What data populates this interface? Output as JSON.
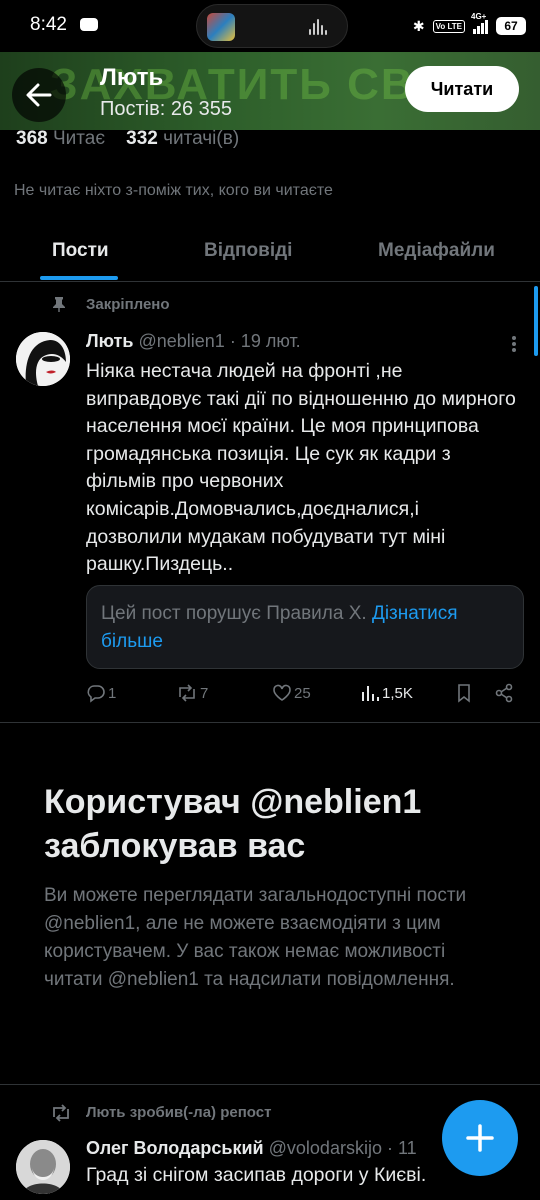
{
  "status_bar": {
    "time": "8:42",
    "battery": "67",
    "network": "4G+",
    "volte": "Vo LTE"
  },
  "header": {
    "banner_text": "ЗАХВАТИТЬ СВ",
    "name": "Лють",
    "posts_count": "Постів: 26 355",
    "follow_label": "Читати"
  },
  "stats": {
    "following_count": "368",
    "following_label": "Читає",
    "followers_count": "332",
    "followers_label": "читачі(в)"
  },
  "not_followed_text": "Не читає ніхто з-поміж тих, кого ви читаєте",
  "tabs": [
    {
      "label": "Пости"
    },
    {
      "label": "Відповіді"
    },
    {
      "label": "Медіафайли"
    }
  ],
  "pinned_post": {
    "pinned_label": "Закріплено",
    "author_name": "Лють",
    "handle": "@neblien1",
    "date": "· 19 лют.",
    "text": "Ніяка нестача людей на фронті ,не виправдовує такі дії по відношенню до мирного населення моєї країни. Це моя принципова громадянська позиція. Це сук як кадри з фільмів про червоних комісарів.Домовчались,доєдналися,і дозволили мудакам побудувати тут міні рашку.Пиздець..",
    "notice_text": "Цей пост порушує Правила X.",
    "notice_link": "Дізнатися більше",
    "replies": "1",
    "reposts": "7",
    "likes": "25",
    "views": "1,5K"
  },
  "blocked": {
    "title": "Користувач @neblien1 заблокував вас",
    "text": "Ви можете переглядати загальнодоступні пости @neblien1, але не можете взаємодіяти з цим користувачем. У вас також немає можливості читати @neblien1 та надсилати повідомлення."
  },
  "repost": {
    "label": "Лють зробив(-ла) репост",
    "author_name": "Олег Володарський",
    "handle": "@volodarskijo",
    "date": "· 11",
    "text": "Град зі снігом засипав дороги у Києві."
  },
  "colors": {
    "accent": "#1d9bf0",
    "background": "#000000",
    "muted": "#71767b",
    "text": "#e7e9ea"
  }
}
